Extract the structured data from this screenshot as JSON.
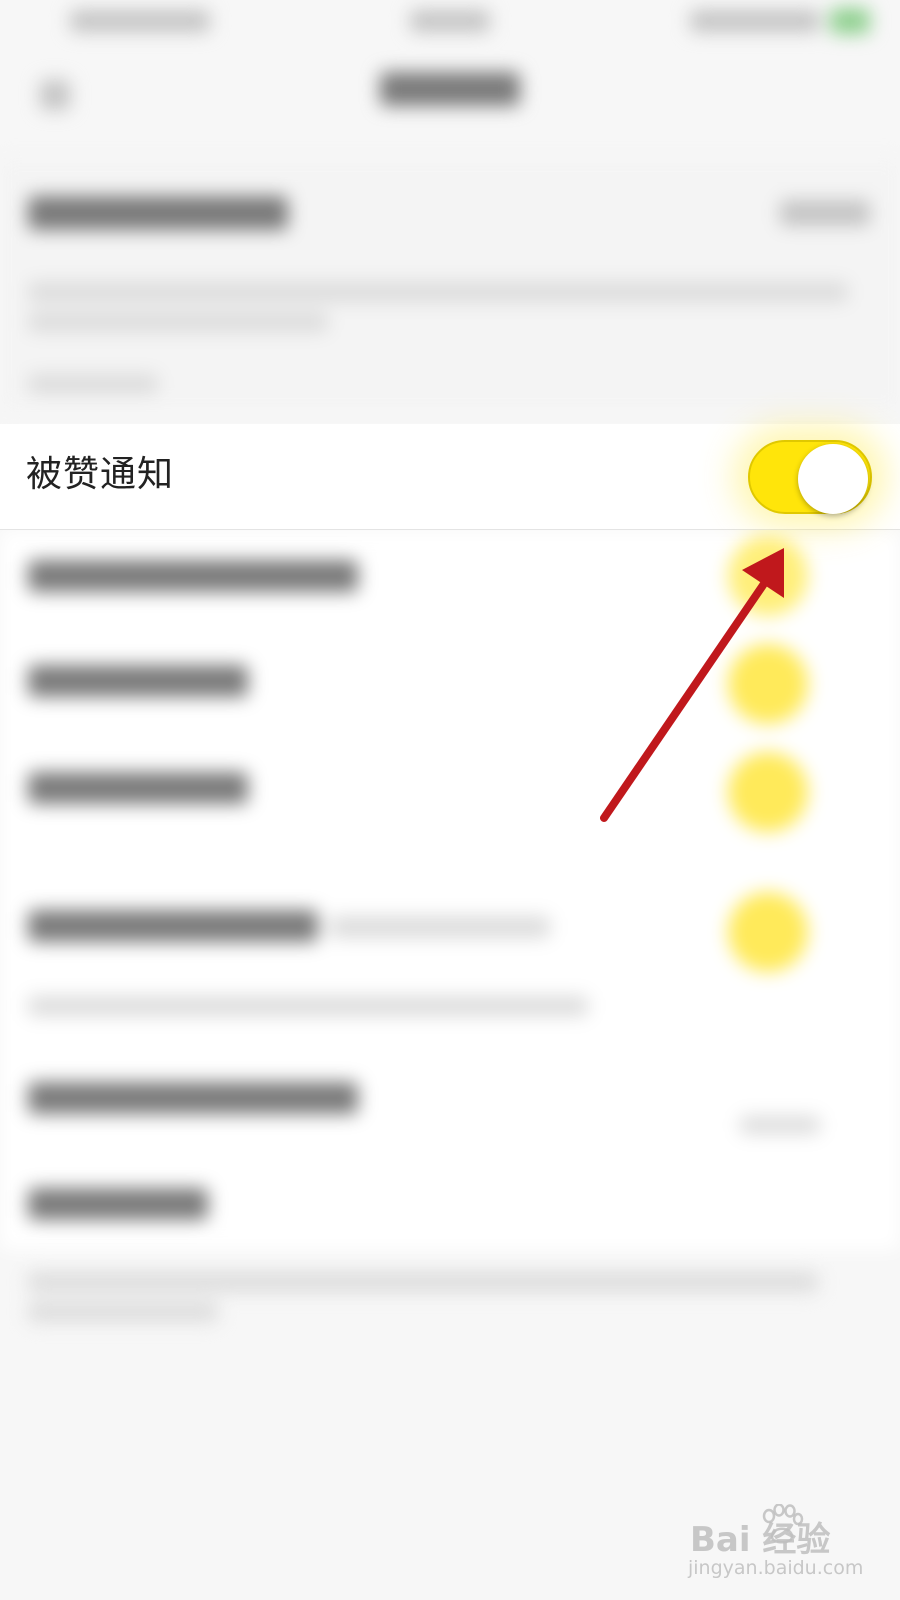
{
  "setting_row": {
    "label": "被赞通知",
    "toggle_on": true
  },
  "colors": {
    "toggle_track": "#ffe50a",
    "toggle_border": "#e0c800",
    "arrow": "#c0181c",
    "background": "#f7f7f7"
  },
  "watermark": {
    "logo": "Bai 经验",
    "url": "jingyan.baidu.com"
  }
}
